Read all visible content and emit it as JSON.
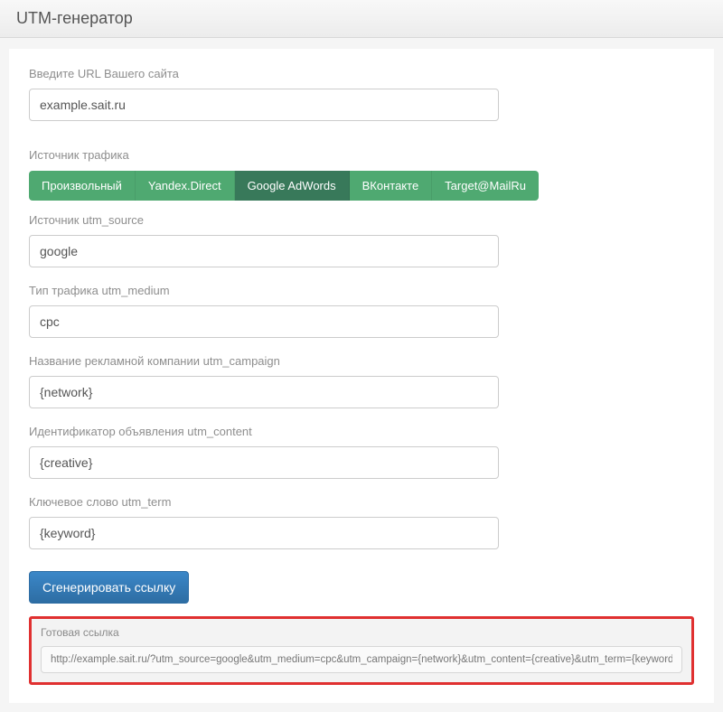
{
  "header": {
    "title": "UTM-генератор"
  },
  "fields": {
    "url": {
      "label": "Введите URL Вашего сайта",
      "value": "example.sait.ru"
    },
    "traffic_source_label": "Источник трафика",
    "source": {
      "label": "Источник utm_source",
      "value": "google"
    },
    "medium": {
      "label": "Тип трафика utm_medium",
      "value": "cpc"
    },
    "campaign": {
      "label": "Название рекламной компании utm_campaign",
      "value": "{network}"
    },
    "content": {
      "label": "Идентификатор объявления utm_content",
      "value": "{creative}"
    },
    "term": {
      "label": "Ключевое слово utm_term",
      "value": "{keyword}"
    }
  },
  "tabs": [
    {
      "label": "Произвольный",
      "active": false
    },
    {
      "label": "Yandex.Direct",
      "active": false
    },
    {
      "label": "Google AdWords",
      "active": true
    },
    {
      "label": "ВКонтакте",
      "active": false
    },
    {
      "label": "Target@MailRu",
      "active": false
    }
  ],
  "generate_button": "Сгенерировать ссылку",
  "result": {
    "label": "Готовая ссылка",
    "value": "http://example.sait.ru/?utm_source=google&utm_medium=cpc&utm_campaign={network}&utm_content={creative}&utm_term={keyword}"
  }
}
